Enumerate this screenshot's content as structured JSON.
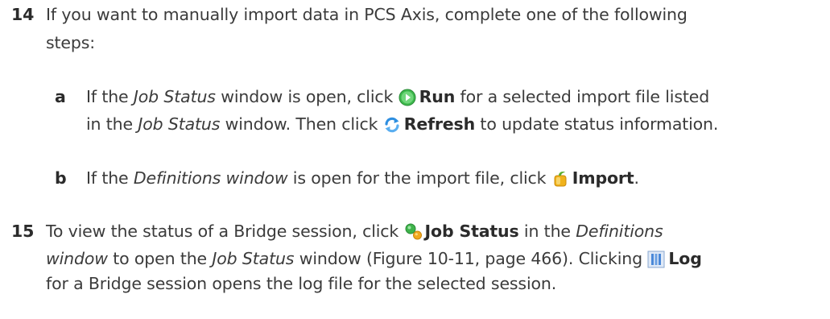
{
  "colors": {
    "text": "#3b3b3b",
    "bold_text": "#2b2b2b",
    "run_icon": "#3db84c",
    "refresh_icon": "#2f8fe0",
    "import_icon": "#f0b21b",
    "job_status_green": "#3eb34b",
    "job_status_orange": "#f2a81d",
    "log_icon": "#4a88d8"
  },
  "step14": {
    "number": "14",
    "line1": "If you want to manually import data in PCS Axis, complete one of the following",
    "line2": "steps:"
  },
  "step14a": {
    "letter": "a",
    "l1_pre": "If the ",
    "l1_job_status": "Job Status",
    "l1_mid": " window is open, click ",
    "run_icon": "run-icon",
    "run_label": "Run",
    "l1_post": " for a selected import file listed",
    "l2_pre": "in the ",
    "l2_job_status": "Job Status",
    "l2_mid": " window. Then click ",
    "refresh_icon": "refresh-icon",
    "refresh_label": "Refresh",
    "l2_post": " to update status information."
  },
  "step14b": {
    "letter": "b",
    "pre": "If the ",
    "definitions_window": "Definitions window",
    "mid": " is open for the import file, click ",
    "import_icon": "import-icon",
    "import_label": "Import",
    "post": "."
  },
  "step15": {
    "number": "15",
    "l1_pre": "To view the status of a Bridge session, click ",
    "job_status_icon": "job-status-icon",
    "job_status_label": "Job Status",
    "l1_mid": " in the ",
    "l1_definitions": "Definitions",
    "l2_window": "window",
    "l2_mid": " to open the ",
    "l2_job_status": "Job Status",
    "l2_post": " window (Figure 10-11, page 466). Clicking ",
    "log_icon": "log-icon",
    "log_label": "Log",
    "l3": "for a Bridge session opens the log file for the selected session."
  }
}
